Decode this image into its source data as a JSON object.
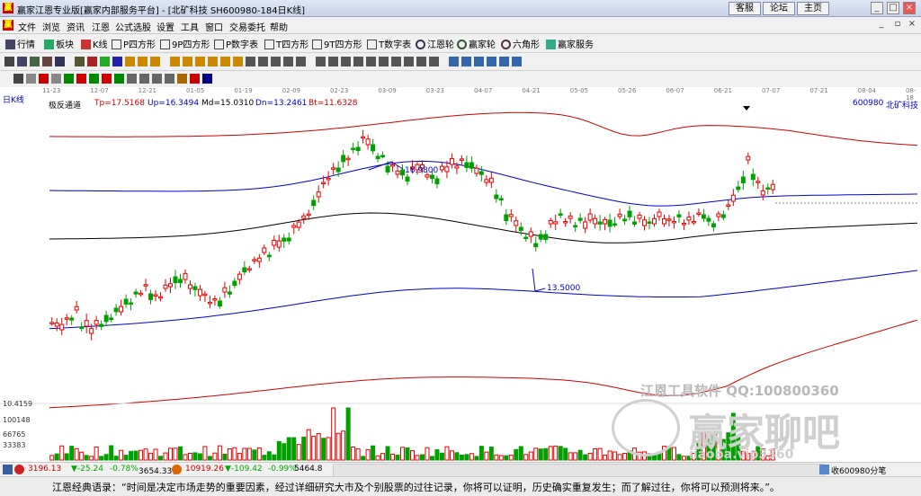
{
  "window": {
    "title": "赢家江恩专业版[赢家内部服务平台] - [北矿科技  SH600980-184日K线]",
    "top_links": [
      "客服",
      "论坛",
      "主页"
    ],
    "controls": [
      "_",
      "□",
      "×"
    ]
  },
  "menu": [
    "文件",
    "浏览",
    "资讯",
    "江恩",
    "公式选股",
    "设置",
    "工具",
    "窗口",
    "交易委托",
    "帮助"
  ],
  "toolbar1": [
    "行情",
    "板块",
    "K线",
    "P四方形",
    "9P四方形",
    "P数字表",
    "T四方形",
    "9T四方形",
    "T数字表",
    "江恩轮",
    "赢家轮",
    "六角形",
    "赢家服务"
  ],
  "date_axis": [
    "11-23",
    "12-07",
    "12-21",
    "01-05",
    "01-19",
    "02-09",
    "02-23",
    "03-09",
    "03-23",
    "04-07",
    "04-21",
    "05-05",
    "05-26",
    "06-07",
    "06-21",
    "07-07",
    "07-21",
    "08-04",
    "08-18"
  ],
  "chart_header": {
    "period_label": "日K线",
    "indicator_name": "极反通道",
    "tp": "Tp=17.5168",
    "up": "Up=16.3494",
    "md": "Md=15.0310",
    "dn": "Dn=13.2461",
    "bt": "Bt=11.6328",
    "stock_code": "600980",
    "stock_name": "北矿科技"
  },
  "annotations": {
    "high_label": "16.9800",
    "low_label": "13.5000"
  },
  "volume_axis": [
    "10.4159",
    "100148",
    "66765",
    "33383"
  ],
  "watermark": {
    "line1": "江恩工具软件  QQ:100800360",
    "line2": "赢家聊吧",
    "line3": "iiaoba.vip3360"
  },
  "status": {
    "sh_index": "3196.13",
    "sh_change": "▼-25.24",
    "sh_pct": "-0.78%",
    "sh_amount": "3654.33亿",
    "sz_index": "10919.26",
    "sz_change": "▼-109.42",
    "sz_pct": "-0.99%",
    "sz_amount": "5464.8",
    "right_label": "收600980分笔"
  },
  "quote": "江恩经典语录：“时间是决定市场走势的重要因素，经过详细研究大市及个别股票的过往记录，你将可以证明，历史确实重复发生；而了解过往，你将可以预测将来。”。",
  "colors": {
    "up": "#e60000",
    "down": "#00a000",
    "upper_band": "#cc0000",
    "channel": "#0000cc",
    "mid": "#000000"
  },
  "chart_data": {
    "type": "candlestick",
    "title": "北矿科技 600980 日K线",
    "bands": {
      "tp": 17.5168,
      "up": 16.3494,
      "md": 15.031,
      "dn": 13.2461,
      "bt": 11.6328
    },
    "high": 16.98,
    "low": 13.5,
    "volume_ticks": [
      33383,
      66765,
      100148
    ]
  }
}
